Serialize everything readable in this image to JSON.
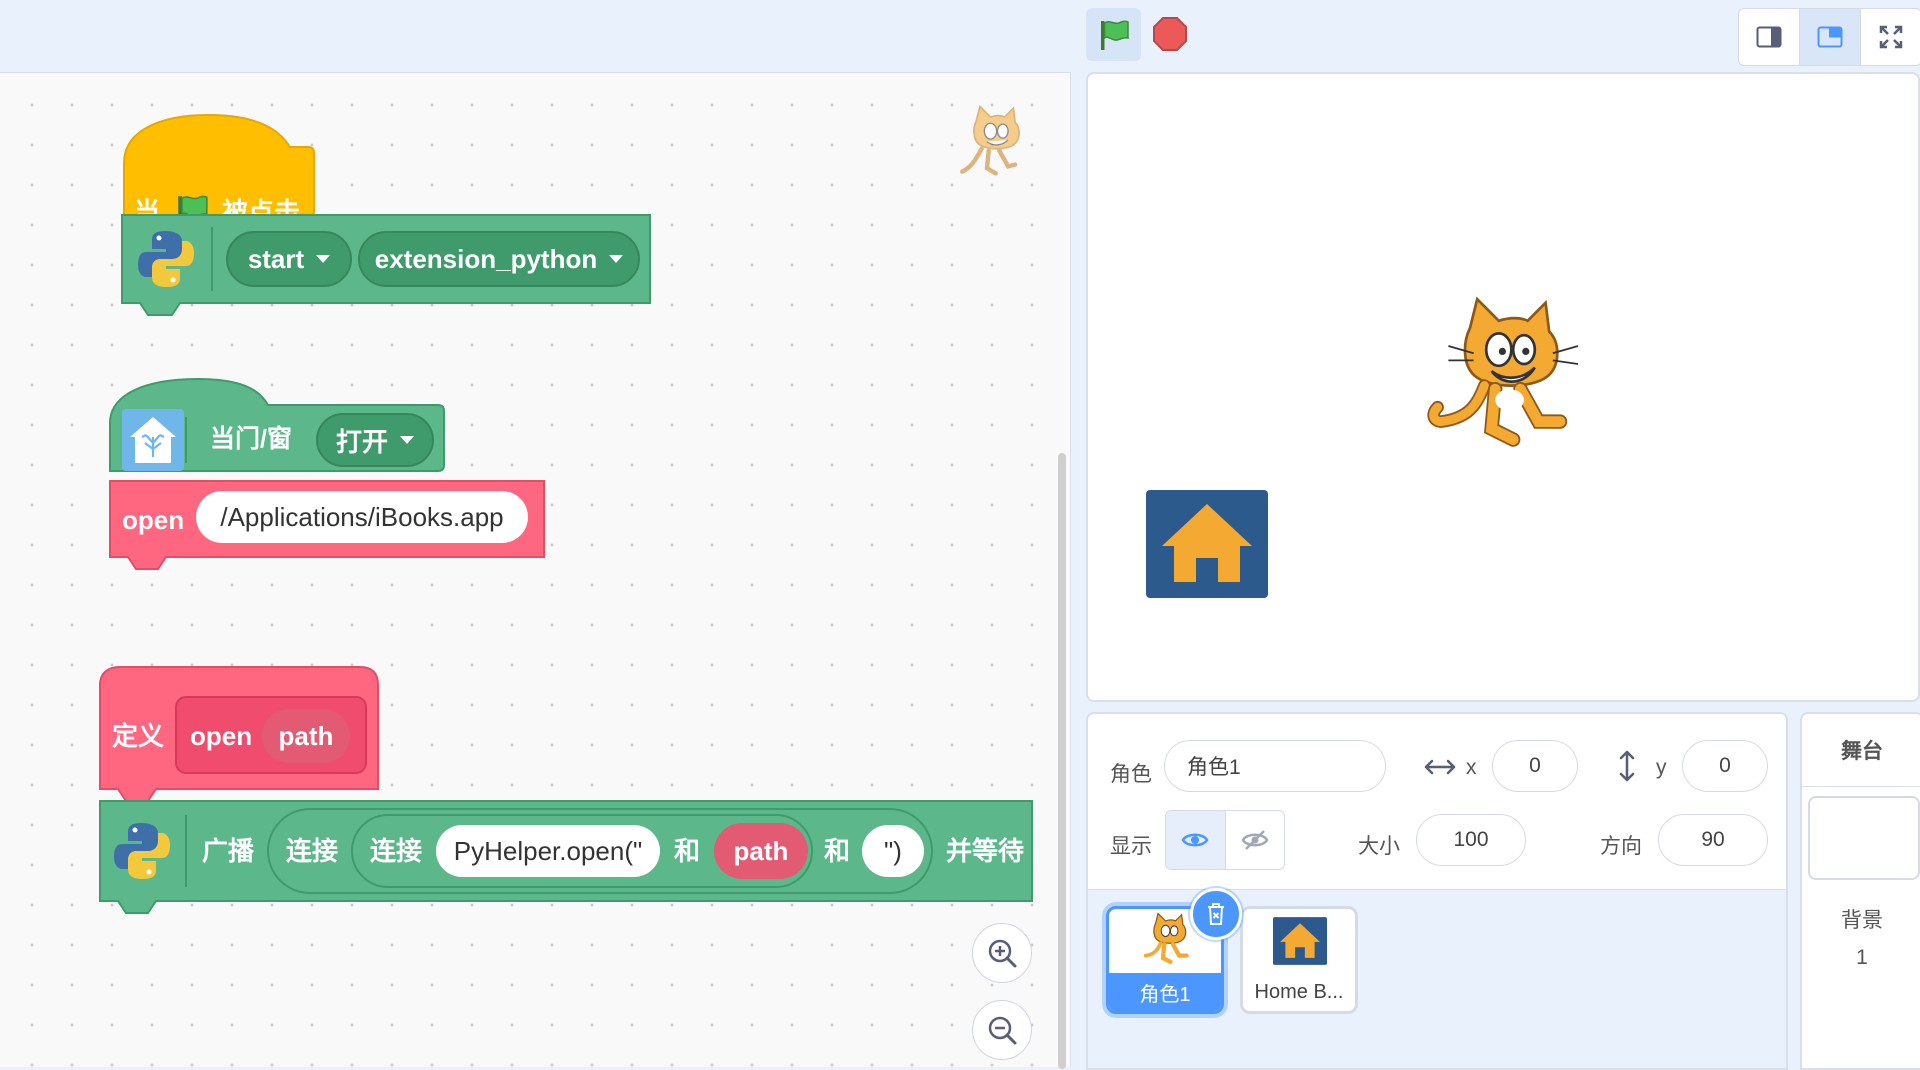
{
  "toolbar": {
    "green_flag": "green-flag-icon",
    "stop": "stop-icon",
    "modes": [
      "small-stage-icon",
      "normal-stage-icon",
      "fullscreen-icon"
    ]
  },
  "blocks": {
    "when_flag": {
      "prefix": "当",
      "suffix": "被点击"
    },
    "python1": {
      "dropdown1": "start",
      "dropdown2": "extension_python"
    },
    "homekit": {
      "label": "当门/窗",
      "dropdown": "打开"
    },
    "open_cmd": {
      "label": "open",
      "value": "/Applications/iBooks.app"
    },
    "define": {
      "label": "定义",
      "name": "open",
      "param": "path"
    },
    "broadcast": {
      "label": "广播",
      "join1": "连接",
      "join2": "连接",
      "str1": "PyHelper.open(\"",
      "and1": "和",
      "arg": "path",
      "and2": "和",
      "str2": "\")",
      "suffix": "并等待"
    }
  },
  "sprite_info": {
    "sprite_label": "角色",
    "sprite_name": "角色1",
    "x_label": "x",
    "x_value": "0",
    "y_label": "y",
    "y_value": "0",
    "show_label": "显示",
    "size_label": "大小",
    "size_value": "100",
    "direction_label": "方向",
    "direction_value": "90"
  },
  "sprites": [
    {
      "name": "角色1",
      "selected": true
    },
    {
      "name": "Home B...",
      "selected": false
    }
  ],
  "stage_panel": {
    "title": "舞台",
    "backdrop_label": "背景",
    "backdrop_count": "1"
  },
  "colors": {
    "events": "#ffbf00",
    "extension": "#5cb88a",
    "custom": "#ff6680",
    "accent": "#4c97ff",
    "house_bg": "#2d5a8c",
    "house": "#f4a933"
  }
}
